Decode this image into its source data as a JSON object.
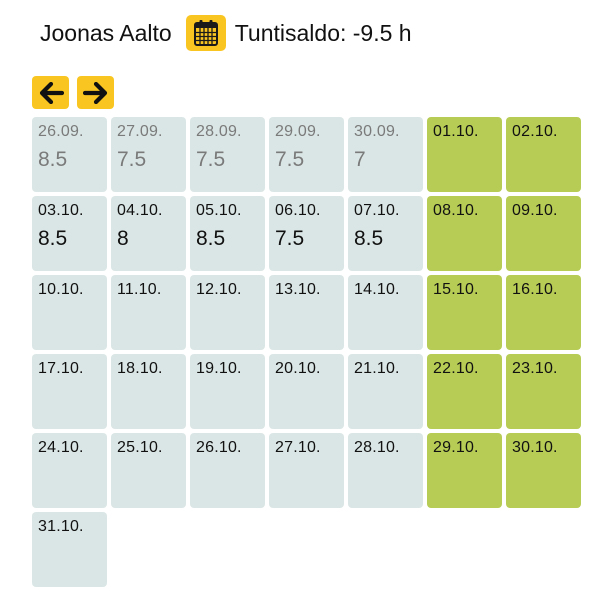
{
  "header": {
    "user_name": "Joonas Aalto",
    "calendar_icon": "calendar-icon",
    "balance_text": "Tuntisaldo: -9.5 h"
  },
  "nav": {
    "prev_icon": "arrow-left-icon",
    "next_icon": "arrow-right-icon"
  },
  "colors": {
    "accent": "#f9c621",
    "weekday_cell": "#dae6e5",
    "weekend_cell": "#b7cc55",
    "past_text": "#7a7a7a"
  },
  "days": [
    {
      "date": "26.09.",
      "hours": "8.5",
      "weekend": false,
      "past": true
    },
    {
      "date": "27.09.",
      "hours": "7.5",
      "weekend": false,
      "past": true
    },
    {
      "date": "28.09.",
      "hours": "7.5",
      "weekend": false,
      "past": true
    },
    {
      "date": "29.09.",
      "hours": "7.5",
      "weekend": false,
      "past": true
    },
    {
      "date": "30.09.",
      "hours": "7",
      "weekend": false,
      "past": true
    },
    {
      "date": "01.10.",
      "hours": "",
      "weekend": true,
      "past": false
    },
    {
      "date": "02.10.",
      "hours": "",
      "weekend": true,
      "past": false
    },
    {
      "date": "03.10.",
      "hours": "8.5",
      "weekend": false,
      "past": false
    },
    {
      "date": "04.10.",
      "hours": "8",
      "weekend": false,
      "past": false
    },
    {
      "date": "05.10.",
      "hours": "8.5",
      "weekend": false,
      "past": false
    },
    {
      "date": "06.10.",
      "hours": "7.5",
      "weekend": false,
      "past": false
    },
    {
      "date": "07.10.",
      "hours": "8.5",
      "weekend": false,
      "past": false
    },
    {
      "date": "08.10.",
      "hours": "",
      "weekend": true,
      "past": false
    },
    {
      "date": "09.10.",
      "hours": "",
      "weekend": true,
      "past": false
    },
    {
      "date": "10.10.",
      "hours": "",
      "weekend": false,
      "past": false
    },
    {
      "date": "11.10.",
      "hours": "",
      "weekend": false,
      "past": false
    },
    {
      "date": "12.10.",
      "hours": "",
      "weekend": false,
      "past": false
    },
    {
      "date": "13.10.",
      "hours": "",
      "weekend": false,
      "past": false
    },
    {
      "date": "14.10.",
      "hours": "",
      "weekend": false,
      "past": false
    },
    {
      "date": "15.10.",
      "hours": "",
      "weekend": true,
      "past": false
    },
    {
      "date": "16.10.",
      "hours": "",
      "weekend": true,
      "past": false
    },
    {
      "date": "17.10.",
      "hours": "",
      "weekend": false,
      "past": false
    },
    {
      "date": "18.10.",
      "hours": "",
      "weekend": false,
      "past": false
    },
    {
      "date": "19.10.",
      "hours": "",
      "weekend": false,
      "past": false
    },
    {
      "date": "20.10.",
      "hours": "",
      "weekend": false,
      "past": false
    },
    {
      "date": "21.10.",
      "hours": "",
      "weekend": false,
      "past": false
    },
    {
      "date": "22.10.",
      "hours": "",
      "weekend": true,
      "past": false
    },
    {
      "date": "23.10.",
      "hours": "",
      "weekend": true,
      "past": false
    },
    {
      "date": "24.10.",
      "hours": "",
      "weekend": false,
      "past": false
    },
    {
      "date": "25.10.",
      "hours": "",
      "weekend": false,
      "past": false
    },
    {
      "date": "26.10.",
      "hours": "",
      "weekend": false,
      "past": false
    },
    {
      "date": "27.10.",
      "hours": "",
      "weekend": false,
      "past": false
    },
    {
      "date": "28.10.",
      "hours": "",
      "weekend": false,
      "past": false
    },
    {
      "date": "29.10.",
      "hours": "",
      "weekend": true,
      "past": false
    },
    {
      "date": "30.10.",
      "hours": "",
      "weekend": true,
      "past": false
    },
    {
      "date": "31.10.",
      "hours": "",
      "weekend": false,
      "past": false
    }
  ]
}
